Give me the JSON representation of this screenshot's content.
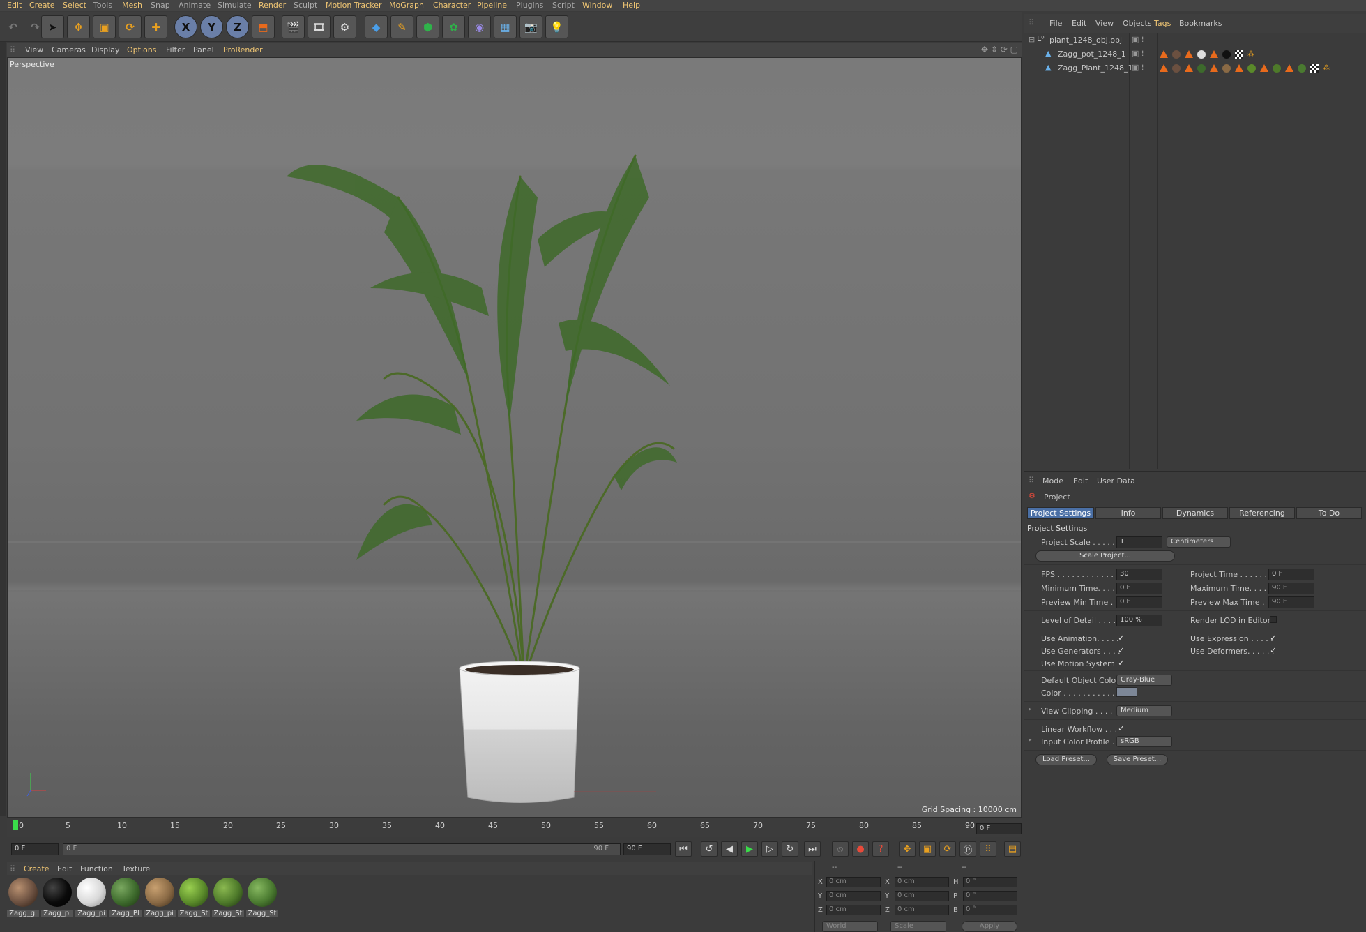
{
  "menubar": {
    "items": [
      {
        "label": "Edit",
        "hl": true
      },
      {
        "label": "Create",
        "hl": true
      },
      {
        "label": "Select",
        "hl": true
      },
      {
        "label": "Tools",
        "hl": false
      },
      {
        "label": "Mesh",
        "hl": true
      },
      {
        "label": "Snap",
        "hl": false
      },
      {
        "label": "Animate",
        "hl": false
      },
      {
        "label": "Simulate",
        "hl": false
      },
      {
        "label": "Render",
        "hl": true
      },
      {
        "label": "Sculpt",
        "hl": false
      },
      {
        "label": "Motion Tracker",
        "hl": true
      },
      {
        "label": "MoGraph",
        "hl": true
      },
      {
        "label": "Character",
        "hl": true
      },
      {
        "label": "Pipeline",
        "hl": true
      },
      {
        "label": "Plugins",
        "hl": false
      },
      {
        "label": "Script",
        "hl": false
      },
      {
        "label": "Window",
        "hl": true
      },
      {
        "label": "Help",
        "hl": true
      }
    ]
  },
  "toolbar": {
    "axis_x": "X",
    "axis_y": "Y",
    "axis_z": "Z"
  },
  "viewport_menu": {
    "items": [
      "View",
      "Cameras",
      "Display",
      "Options",
      "Filter",
      "Panel",
      "ProRender"
    ],
    "highlighted": [
      "Options",
      "ProRender"
    ]
  },
  "viewport": {
    "camera_label": "Perspective",
    "grid_spacing": "Grid Spacing : 10000 cm"
  },
  "timeline": {
    "ticks": [
      "0",
      "5",
      "10",
      "15",
      "20",
      "25",
      "30",
      "35",
      "40",
      "45",
      "50",
      "55",
      "60",
      "65",
      "70",
      "75",
      "80",
      "85",
      "90"
    ],
    "current_frame": "0 F"
  },
  "playback": {
    "start_field": "0 F",
    "range_start": "0 F",
    "range_end": "90 F",
    "end_field": "90 F"
  },
  "material_manager": {
    "menu": [
      "Create",
      "Edit",
      "Function",
      "Texture"
    ],
    "materials": [
      {
        "label": "Zagg_gi",
        "color": "#6b5040"
      },
      {
        "label": "Zagg_pi",
        "color": "#0a0a0a"
      },
      {
        "label": "Zagg_pi",
        "color": "#d8d8d8"
      },
      {
        "label": "Zagg_Pl",
        "color": "#3d6a2c"
      },
      {
        "label": "Zagg_pi",
        "color": "#8a6a45"
      },
      {
        "label": "Zagg_St",
        "color": "#5a8a2a"
      },
      {
        "label": "Zagg_St",
        "color": "#4e7a2a"
      },
      {
        "label": "Zagg_St",
        "color": "#4a7a30"
      }
    ]
  },
  "coord_manager": {
    "headers": [
      "--",
      "--",
      "--"
    ],
    "rows": [
      {
        "axis_a": "X",
        "val_a": "0 cm",
        "axis_b": "X",
        "val_b": "0 cm",
        "axis_c": "H",
        "val_c": "0 °"
      },
      {
        "axis_a": "Y",
        "val_a": "0 cm",
        "axis_b": "Y",
        "val_b": "0 cm",
        "axis_c": "P",
        "val_c": "0 °"
      },
      {
        "axis_a": "Z",
        "val_a": "0 cm",
        "axis_b": "Z",
        "val_b": "0 cm",
        "axis_c": "B",
        "val_c": "0 °"
      }
    ],
    "world": "World",
    "scale": "Scale",
    "apply": "Apply"
  },
  "object_manager": {
    "menu": [
      "File",
      "Edit",
      "View",
      "Objects",
      "Tags",
      "Bookmarks"
    ],
    "objects": [
      {
        "name": "plant_1248_obj.obj"
      },
      {
        "name": "Zagg_pot_1248_1"
      },
      {
        "name": "Zagg_Plant_1248_1"
      }
    ]
  },
  "attribute_manager": {
    "menu": [
      "Mode",
      "Edit",
      "User Data"
    ],
    "object_label": "Project",
    "tabs": [
      "Project Settings",
      "Info",
      "Dynamics",
      "Referencing",
      "To Do"
    ],
    "section": "Project Settings",
    "project_scale_label": "Project Scale . . . . . .",
    "project_scale_value": "1",
    "project_scale_unit": "Centimeters",
    "scale_project_btn": "Scale Project...",
    "fps_label": "FPS . . . . . . . . . . . . .",
    "fps_value": "30",
    "project_time_label": "Project Time . . . . . . . .",
    "project_time_value": "0 F",
    "min_time_label": "Minimum Time. . . . . .",
    "min_time_value": "0 F",
    "max_time_label": "Maximum Time. . . . . .",
    "max_time_value": "90 F",
    "prev_min_label": "Preview Min Time . . .",
    "prev_min_value": "0 F",
    "prev_max_label": "Preview Max Time . . .",
    "prev_max_value": "90 F",
    "lod_label": "Level of Detail . . . . .",
    "lod_value": "100 %",
    "render_lod_label": "Render LOD in Editor",
    "use_anim_label": "Use Animation. . . . .",
    "use_expr_label": "Use Expression . . . . .",
    "use_gen_label": "Use Generators . . . .",
    "use_deform_label": "Use Deformers. . . . . .",
    "use_motion_label": "Use Motion System",
    "def_color_label": "Default Object Color",
    "def_color_value": "Gray-Blue",
    "color_label": "Color . . . . . . . . . . .",
    "color_swatch": "#7d8797",
    "view_clip_label": "View Clipping . . . . .",
    "view_clip_value": "Medium",
    "linear_wf_label": "Linear Workflow . . .",
    "input_profile_label": "Input Color Profile .",
    "input_profile_value": "sRGB",
    "load_preset": "Load Preset...",
    "save_preset": "Save Preset...",
    "check": "✓"
  }
}
